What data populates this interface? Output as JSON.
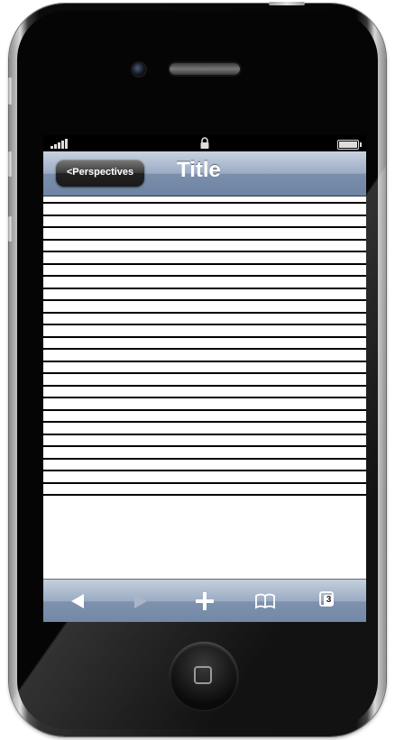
{
  "nav": {
    "back_label": "<Perspectives",
    "title": "Title"
  },
  "list": {
    "row_count": 25
  },
  "toolbar": {
    "items": [
      {
        "icon": "back-arrow-icon"
      },
      {
        "icon": "forward-arrow-icon"
      },
      {
        "icon": "plus-icon"
      },
      {
        "icon": "bookmarks-icon"
      },
      {
        "icon": "tabs-icon"
      }
    ],
    "tabs_count": "3"
  },
  "colors": {
    "nav_bar": "#8fa1bc",
    "back_button": "#2a2a2a",
    "list_line": "#000000",
    "phone_body": "#050505"
  }
}
